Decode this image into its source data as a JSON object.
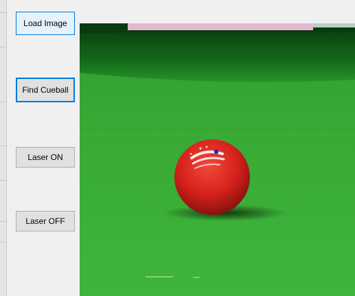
{
  "window": {
    "buttons": {
      "load_image": "Load Image",
      "find_cueball": "Find Cueball",
      "laser_on": "Laser ON",
      "laser_off": "Laser OFF"
    }
  },
  "image_view": {
    "content": "snooker table photo with red ball",
    "colors": {
      "cloth": "#3aae34",
      "cushion": "#0f5e16",
      "ball": "#d8221b",
      "marker": "#2e20c8"
    }
  }
}
